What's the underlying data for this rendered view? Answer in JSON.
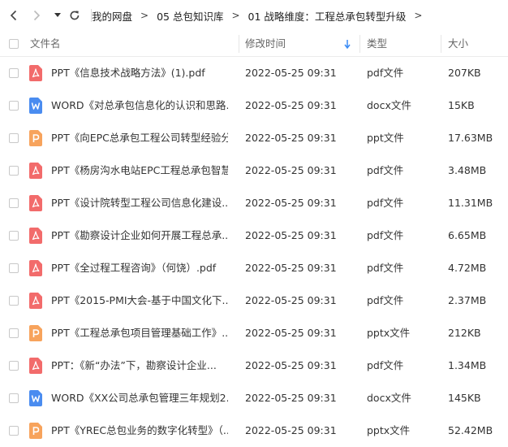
{
  "toolbar": {
    "back_icon": "chevron-left-icon",
    "forward_icon": "chevron-right-icon",
    "history_icon": "caret-down-icon",
    "refresh_icon": "refresh-icon"
  },
  "breadcrumb": [
    "我的网盘",
    "05 总包知识库",
    "01 战略维度：工程总承包转型升级"
  ],
  "breadcrumb_separator": ">",
  "columns": {
    "name": "文件名",
    "modified": "修改时间",
    "type": "类型",
    "size": "大小"
  },
  "colors": {
    "pdf": "#f26b6b",
    "docx": "#4a8cf0",
    "ppt": "#f7a35c",
    "sort_arrow": "#3b8cf5"
  },
  "files": [
    {
      "kind": "pdf",
      "name": "PPT《信息技术战略方法》(1).pdf",
      "date": "2022-05-25 09:31",
      "type": "pdf文件",
      "size": "207KB"
    },
    {
      "kind": "docx",
      "name": "WORD《对总承包信息化的认识和思路...",
      "date": "2022-05-25 09:31",
      "type": "docx文件",
      "size": "15KB"
    },
    {
      "kind": "ppt",
      "name": "PPT《向EPC总承包工程公司转型经验分...",
      "date": "2022-05-25 09:31",
      "type": "ppt文件",
      "size": "17.63MB"
    },
    {
      "kind": "pdf",
      "name": "PPT《杨房沟水电站EPC工程总承包智慧...",
      "date": "2022-05-25 09:31",
      "type": "pdf文件",
      "size": "3.48MB"
    },
    {
      "kind": "pdf",
      "name": "PPT《设计院转型工程公司信息化建设...",
      "date": "2022-05-25 09:31",
      "type": "pdf文件",
      "size": "11.31MB"
    },
    {
      "kind": "pdf",
      "name": "PPT《勘察设计企业如何开展工程总承...",
      "date": "2022-05-25 09:31",
      "type": "pdf文件",
      "size": "6.65MB"
    },
    {
      "kind": "pdf",
      "name": "PPT《全过程工程咨询》（何饶）.pdf",
      "date": "2022-05-25 09:31",
      "type": "pdf文件",
      "size": "4.72MB"
    },
    {
      "kind": "pdf",
      "name": "PPT《2015-PMI大会-基于中国文化下...",
      "date": "2022-05-25 09:31",
      "type": "pdf文件",
      "size": "2.37MB"
    },
    {
      "kind": "ppt",
      "name": "PPT《工程总承包项目管理基础工作》...",
      "date": "2022-05-25 09:31",
      "type": "pptx文件",
      "size": "212KB"
    },
    {
      "kind": "pdf",
      "name": "PPT：《新“办法”下，勘察设计企业...",
      "date": "2022-05-25 09:31",
      "type": "pdf文件",
      "size": "1.34MB"
    },
    {
      "kind": "docx",
      "name": "WORD《XX公司总承包管理三年规划2...",
      "date": "2022-05-25 09:31",
      "type": "docx文件",
      "size": "145KB"
    },
    {
      "kind": "ppt",
      "name": "PPT《YREC总包业务的数字化转型》（...",
      "date": "2022-05-25 09:31",
      "type": "pptx文件",
      "size": "52.42MB"
    }
  ]
}
